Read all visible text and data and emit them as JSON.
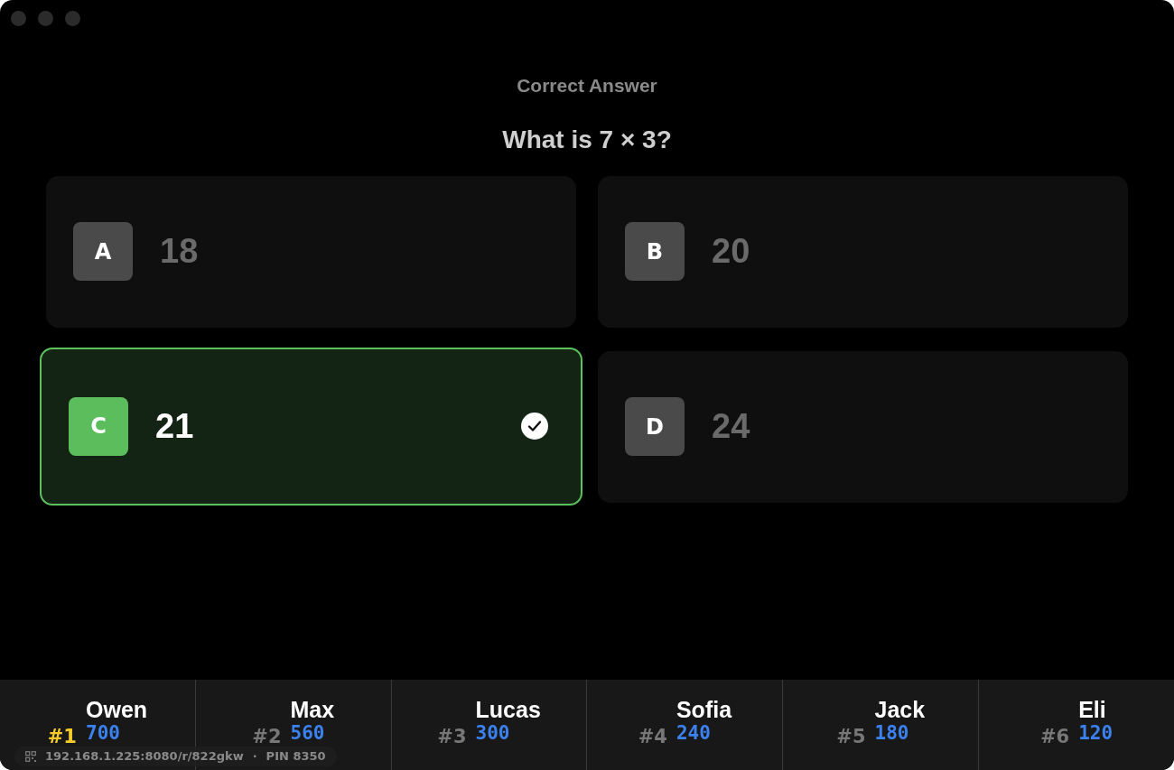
{
  "heading": "Correct Answer",
  "question": "What is 7 × 3?",
  "answers": [
    {
      "letter": "A",
      "text": "18",
      "correct": false
    },
    {
      "letter": "B",
      "text": "20",
      "correct": false
    },
    {
      "letter": "C",
      "text": "21",
      "correct": true
    },
    {
      "letter": "D",
      "text": "24",
      "correct": false
    }
  ],
  "leaderboard": [
    {
      "rank": "#1",
      "name": "Owen",
      "score": "700",
      "leader": true
    },
    {
      "rank": "#2",
      "name": "Max",
      "score": "560",
      "leader": false
    },
    {
      "rank": "#3",
      "name": "Lucas",
      "score": "300",
      "leader": false
    },
    {
      "rank": "#4",
      "name": "Sofia",
      "score": "240",
      "leader": false
    },
    {
      "rank": "#5",
      "name": "Jack",
      "score": "180",
      "leader": false
    },
    {
      "rank": "#6",
      "name": "Eli",
      "score": "120",
      "leader": false
    }
  ],
  "join_info": {
    "address": "192.168.1.225:8080/r/822gkw",
    "separator": "·",
    "pin": "PIN 8350"
  }
}
